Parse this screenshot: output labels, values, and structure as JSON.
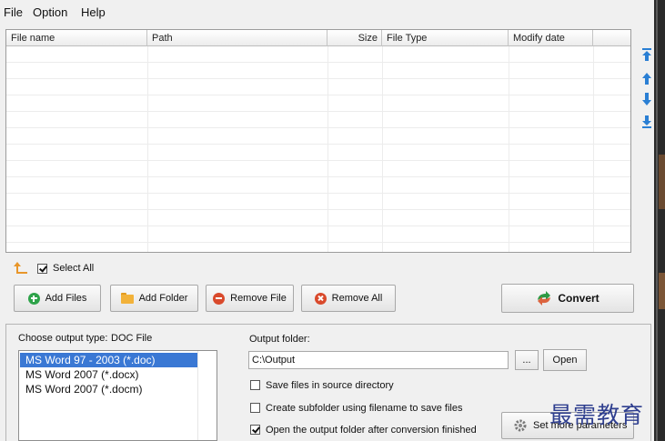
{
  "menu": [
    "File",
    "Option",
    "Help"
  ],
  "table": {
    "columns": [
      "File name",
      "Path",
      "Size",
      "File Type",
      "Modify date"
    ],
    "rows": []
  },
  "side_arrows": [
    "move-top-icon",
    "move-up-icon",
    "move-down-icon",
    "move-bottom-icon"
  ],
  "select_all": {
    "label": "Select All",
    "checked": true
  },
  "buttons": {
    "add_files": "Add Files",
    "add_folder": "Add Folder",
    "remove_file": "Remove File",
    "remove_all": "Remove All",
    "convert": "Convert"
  },
  "output_type": {
    "label": "Choose output type:",
    "value": "DOC File",
    "options": [
      {
        "label": "MS Word 97 - 2003 (*.doc)",
        "selected": true
      },
      {
        "label": "MS Word 2007 (*.docx)",
        "selected": false
      },
      {
        "label": "MS Word 2007 (*.docm)",
        "selected": false
      }
    ]
  },
  "output_folder": {
    "label": "Output folder:",
    "value": "C:\\Output",
    "browse_label": "...",
    "open_label": "Open"
  },
  "options": [
    {
      "label": "Save files in source directory",
      "checked": false
    },
    {
      "label": "Create subfolder using filename to save files",
      "checked": false
    },
    {
      "label": "Open the output folder after conversion finished",
      "checked": true
    }
  ],
  "more_params": "Set more parameters",
  "watermark": "最需教育",
  "colors": {
    "selected": "#3a78d4",
    "watermark": "#2f3f8f"
  }
}
